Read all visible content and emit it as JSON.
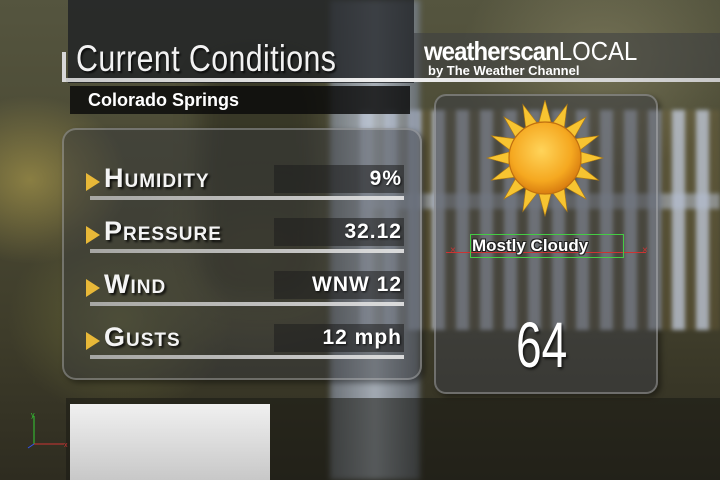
{
  "header": {
    "title": "Current Conditions",
    "logo_bold": "weatherscan",
    "logo_light": "LOCAL",
    "logo_sub": "by The Weather Channel"
  },
  "location": {
    "city": "Colorado Springs"
  },
  "conditions": [
    {
      "label": "Humidity",
      "value": "9%"
    },
    {
      "label": "Pressure",
      "value": "32.12"
    },
    {
      "label": "Wind",
      "value": "WNW 12"
    },
    {
      "label": "Gusts",
      "value": "12 mph"
    }
  ],
  "current": {
    "icon": "sun-icon",
    "description": "Mostly Cloudy",
    "temperature": "64"
  },
  "colors": {
    "accent_arrow": "#e8b838",
    "sun_core": "#f5a820",
    "sun_rays": "#f7c431"
  }
}
